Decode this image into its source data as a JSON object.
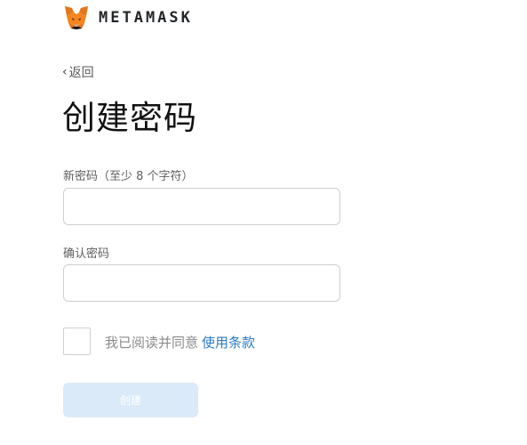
{
  "header": {
    "brand": "METAMASK",
    "logo_icon": "metamask-fox-icon"
  },
  "nav": {
    "back_label": "返回",
    "back_icon": "chevron-left-icon"
  },
  "page": {
    "title": "创建密码"
  },
  "form": {
    "new_password_label": "新密码（至少 8 个字符）",
    "new_password_value": "",
    "confirm_password_label": "确认密码",
    "confirm_password_value": "",
    "agree_text": "我已阅读并同意",
    "terms_link": "使用条款",
    "terms_checked": false,
    "create_button": "创建"
  },
  "colors": {
    "link": "#2b7bc7",
    "button_disabled_bg": "#daeaf8",
    "fox_orange": "#e2761b"
  }
}
